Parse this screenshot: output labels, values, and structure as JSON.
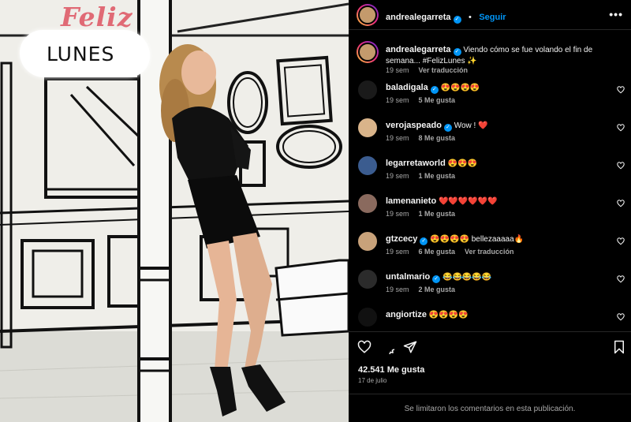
{
  "post": {
    "author": "andrealegarreta",
    "follow_label": "Seguir",
    "more_label": "•••",
    "sticker": {
      "line1": "Feliz",
      "line2": "LUNES"
    }
  },
  "caption": {
    "user": "andrealegarreta",
    "text": "Viendo cómo se fue volando el fin de semana... #FelizLunes ✨",
    "time": "19 sem",
    "translate": "Ver traducción"
  },
  "comments": [
    {
      "user": "baladigala",
      "text": "😍😍😍😍",
      "time": "19 sem",
      "likes": "5 Me gusta",
      "translate": "",
      "verified": true,
      "avatar_color": "#1a1a1a"
    },
    {
      "user": "verojaspeado",
      "text": "Wow ! ❤️",
      "time": "19 sem",
      "likes": "8 Me gusta",
      "translate": "",
      "verified": true,
      "avatar_color": "#d9b48a"
    },
    {
      "user": "legarretaworld",
      "text": "😍😍😍",
      "time": "19 sem",
      "likes": "1 Me gusta",
      "translate": "",
      "verified": false,
      "avatar_color": "#3b5c8f"
    },
    {
      "user": "lamenanieto",
      "text": "❤️❤️❤️❤️❤️❤️",
      "time": "19 sem",
      "likes": "1 Me gusta",
      "translate": "",
      "verified": false,
      "avatar_color": "#8a6a5e"
    },
    {
      "user": "gtzcecy",
      "text": "😍😍😍😍 bellezaaaaa🔥",
      "time": "19 sem",
      "likes": "6 Me gusta",
      "translate": "Ver traducción",
      "verified": true,
      "avatar_color": "#c8a27a"
    },
    {
      "user": "untalmario",
      "text": "😂😂😂😂😂",
      "time": "19 sem",
      "likes": "2 Me gusta",
      "translate": "",
      "verified": true,
      "avatar_color": "#2b2b2b"
    },
    {
      "user": "angiortize",
      "text": "😍😍😍😍",
      "time": "",
      "likes": "",
      "translate": "",
      "verified": false,
      "avatar_color": "#111111"
    }
  ],
  "actions": {
    "likes": "42.541 Me gusta",
    "date": "17 de julio",
    "limited": "Se limitaron los comentarios en esta publicación."
  },
  "icons": [
    "heart-icon",
    "comment-icon",
    "share-icon",
    "bookmark-icon",
    "more-icon",
    "verified-icon"
  ]
}
